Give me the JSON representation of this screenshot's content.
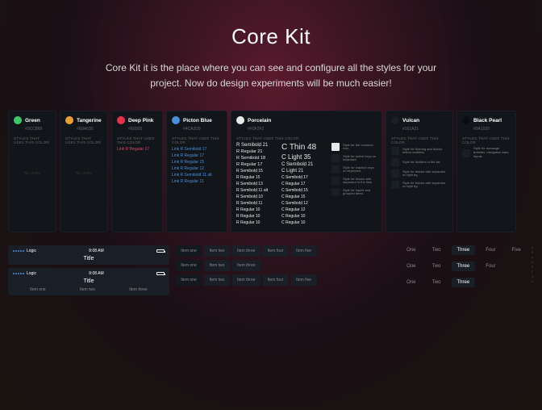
{
  "hero": {
    "title": "Core Kit",
    "subtitle": "Core Kit it is the place where you can see and configure all the styles for your project. Now do design experiments will be much easier!"
  },
  "sectionLabel": "STYLES THAT USES THIS COLOR",
  "noStyles": "No styles",
  "colors": {
    "green": {
      "name": "Green",
      "hex": "#3CC869"
    },
    "tangerine": {
      "name": "Tangerine",
      "hex": "#E8A030"
    },
    "pink": {
      "name": "Deep Pink",
      "hex": "#E8305",
      "links": [
        "Link R Regular 17"
      ]
    },
    "picton": {
      "name": "Picton Blue",
      "hex": "#4CA2D9",
      "links": [
        "Link R Semibold 17",
        "Link R Regular 17",
        "Link R Regular 15",
        "Link R Regular 12",
        "Link R Semibold 11 alt",
        "Link R Regular 11"
      ]
    },
    "porcelain": {
      "name": "Porcelain",
      "hex": "#F0F2F2",
      "col1": [
        "R Semibold 21",
        "R Regular 21",
        "R Semibold 18",
        "R Regular 17",
        "R Semibold 15",
        "R Regular 15",
        "R Semibold 13",
        "R Semibold 11 alt",
        "R Semibold 10",
        "R Semibold 11",
        "R Regular 10",
        "R Regular 10",
        "R Regular 10"
      ],
      "col2": [
        "C Thin 48",
        "C Light 35",
        "C Semibold 21",
        "C Light 21",
        "C Semibold 17",
        "C Regular 17",
        "C Semibold 15",
        "C Regular 15",
        "C Semibold 12",
        "C Regular 12",
        "C Regular 10",
        "C Regular 10"
      ],
      "icons": [
        {
          "light": true,
          "txt": "Style for the common icon."
        },
        {
          "light": false,
          "txt": "Style for active keys on keyboard."
        },
        {
          "light": false,
          "txt": "Style for inactive keys on keyboard."
        },
        {
          "light": false,
          "txt": "Style for blocks with separator in the lists."
        },
        {
          "light": false,
          "txt": "Style for inputs and grouped items."
        }
      ]
    },
    "vulcan": {
      "name": "Vulcan",
      "hex": "#161A21",
      "items": [
        "Style for blurring and blocks bellow bubbles.",
        "Style for dividers in the list.",
        "Style for blocks with separator on light bg.",
        "Style for blocks with separator on light bg."
      ]
    },
    "pearl": {
      "name": "Black Pearl",
      "hex": "#0A1020",
      "items": [
        "Style for message bubbles, navigation bars, inputs."
      ]
    }
  },
  "nav": {
    "carrier": "Logic",
    "time": "8:08 AM",
    "title": "Title",
    "tabs": [
      "Item one",
      "Item two",
      "Item three"
    ]
  },
  "segs": {
    "r1": [
      "Item one",
      "Item two",
      "Item three",
      "Item four",
      "Item five"
    ],
    "r2": [
      "Item one",
      "Item two",
      "Item three"
    ]
  },
  "pills": {
    "r1": [
      "One",
      "Two",
      "Three",
      "Four",
      "Five"
    ],
    "r2": [
      "One",
      "Two",
      "Three",
      "Four"
    ],
    "r3": [
      "One",
      "Two",
      "Three"
    ],
    "active": "Three"
  },
  "vindex": [
    "A",
    "B",
    "C",
    "D",
    "E",
    "F",
    "G",
    "H"
  ]
}
